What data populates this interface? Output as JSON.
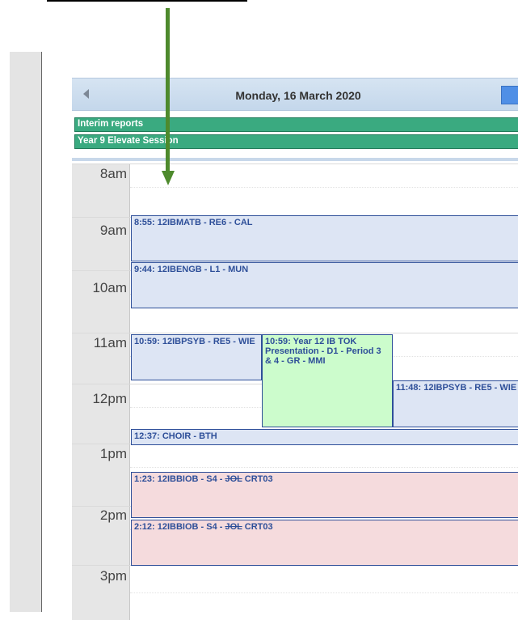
{
  "calendar": {
    "date_title": "Monday, 16 March 2020",
    "banners": [
      "Interim reports",
      "Year 9 Elevate Session"
    ],
    "hours": [
      "8am",
      "9am",
      "10am",
      "11am",
      "12pm",
      "1pm",
      "2pm",
      "3pm"
    ],
    "events": [
      {
        "text": "8:55: 12IBMATB - RE6 - CAL"
      },
      {
        "text": "9:44: 12IBENGB - L1 - MUN"
      },
      {
        "text": "10:59: 12IBPSYB - RE5 - WIE"
      },
      {
        "text": "10:59: Year 12 IB TOK Presentation - D1 - Period 3 & 4 - GR - MMI"
      },
      {
        "text": "11:48: 12IBPSYB - RE5 - WIE"
      },
      {
        "text": "12:37: CHOIR - BTH"
      },
      {
        "pre": "1:23: 12IBBIOB - S4 - ",
        "struck": "JOL",
        "post": " CRT03"
      },
      {
        "pre": "2:12: 12IBBIOB - S4 - ",
        "struck": "JOL",
        "post": " CRT03"
      }
    ]
  },
  "colors": {
    "banner": "#3aaa80",
    "event_blue": "#dde5f4",
    "event_green": "#ccfccc",
    "event_red": "#f5dbdd",
    "event_border": "#2e4f99",
    "arrow": "#4e8a2d",
    "next_button": "#4f8fe6"
  },
  "icons": {
    "prev": "chevron-left-icon",
    "next": "chevron-right-icon"
  }
}
